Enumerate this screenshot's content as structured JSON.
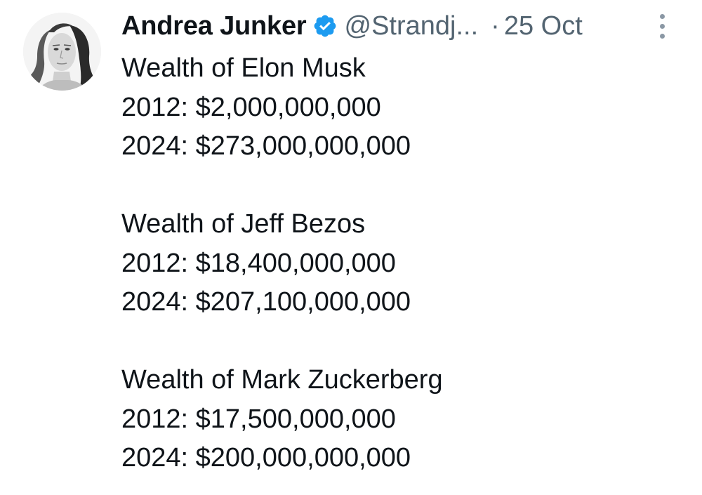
{
  "author": {
    "name": "Andrea Junker",
    "handle": "@Strandj...",
    "separator": "·",
    "date": "25 Oct",
    "verified": true,
    "verified_color": "#1d9bf0"
  },
  "icons": {
    "verified": "verified-badge-icon",
    "more": "more-options-icon"
  },
  "tweet": {
    "blocks": [
      {
        "heading": "Wealth of Elon Musk",
        "line_2012": "2012: $2,000,000,000",
        "line_2024": "2024: $273,000,000,000"
      },
      {
        "heading": "Wealth of Jeff Bezos",
        "line_2012": "2012: $18,400,000,000",
        "line_2024": "2024: $207,100,000,000"
      },
      {
        "heading": "Wealth of Mark Zuckerberg",
        "line_2012": "2012: $17,500,000,000",
        "line_2024": "2024: $200,000,000,000"
      }
    ]
  }
}
